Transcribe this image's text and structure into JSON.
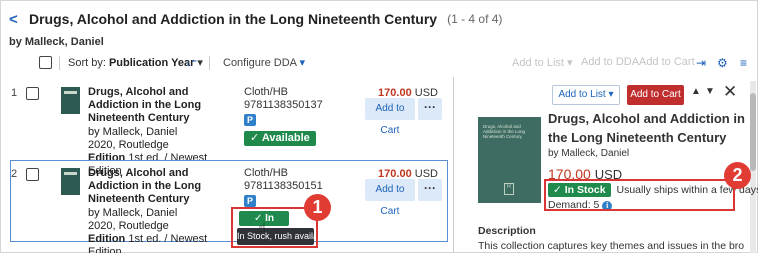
{
  "header": {
    "title": "Drugs, Alcohol and Addiction in the Long Nineteenth Century",
    "count": "(1 - 4 of 4)",
    "byline": "by Malleck, Daniel"
  },
  "toolbar": {
    "sort_label": "Sort by:",
    "sort_value": "Publication Year",
    "configure": "Configure DDA",
    "add_to_list": "Add to List",
    "add_to_dda": "Add to DDA",
    "add_to_cart": "Add to Cart"
  },
  "rows": [
    {
      "num": "1",
      "title": "Drugs, Alcohol and Addiction in the Long Nineteenth Century",
      "author": "by Malleck, Daniel",
      "pub": "2020, Routledge",
      "edition_label": "Edition",
      "edition": "1st ed. / Newest Edition",
      "format": "Cloth/HB",
      "isbn": "9781138350137",
      "badge": "P",
      "status": "✓ Available",
      "price": "170.00",
      "currency": "USD",
      "add_cart": "Add to Cart",
      "more": "···"
    },
    {
      "num": "2",
      "title": "Drugs, Alcohol and Addiction in the Long Nineteenth Century",
      "author": "by Malleck, Daniel",
      "pub": "2020, Routledge",
      "edition_label": "Edition",
      "edition": "1st ed. / Newest Edition",
      "format": "Cloth/HB",
      "isbn": "9781138350151",
      "badge": "P",
      "status": "✓ In Stock",
      "tooltip": "In Stock, rush available",
      "price": "170.00",
      "currency": "USD",
      "add_cart": "Add to Cart",
      "more": "···"
    }
  ],
  "callouts": [
    "1",
    "2"
  ],
  "panel": {
    "add_to_list": "Add to List",
    "add_to_cart": "Add to Cart",
    "close": "✕",
    "title": "Drugs, Alcohol and Addiction in the Long Nineteenth Century",
    "author": "by Malleck, Daniel",
    "price": "170.00",
    "currency": "USD",
    "stock_badge": "✓ In Stock",
    "ships": "Usually ships within a few days",
    "demand": "Demand: 5",
    "desc_heading": "Description",
    "desc_text": "This collection captures key themes and issues in the broad history",
    "cover_title": "Drugs, Alcohol and Addiction in the Long Nineteenth Century"
  },
  "colors": {
    "accent": "#1c62b9",
    "cart_red": "#c02e2e",
    "price_red": "#c0371f",
    "stock_green": "#1f8a4c",
    "callout_red": "#e03c34"
  }
}
